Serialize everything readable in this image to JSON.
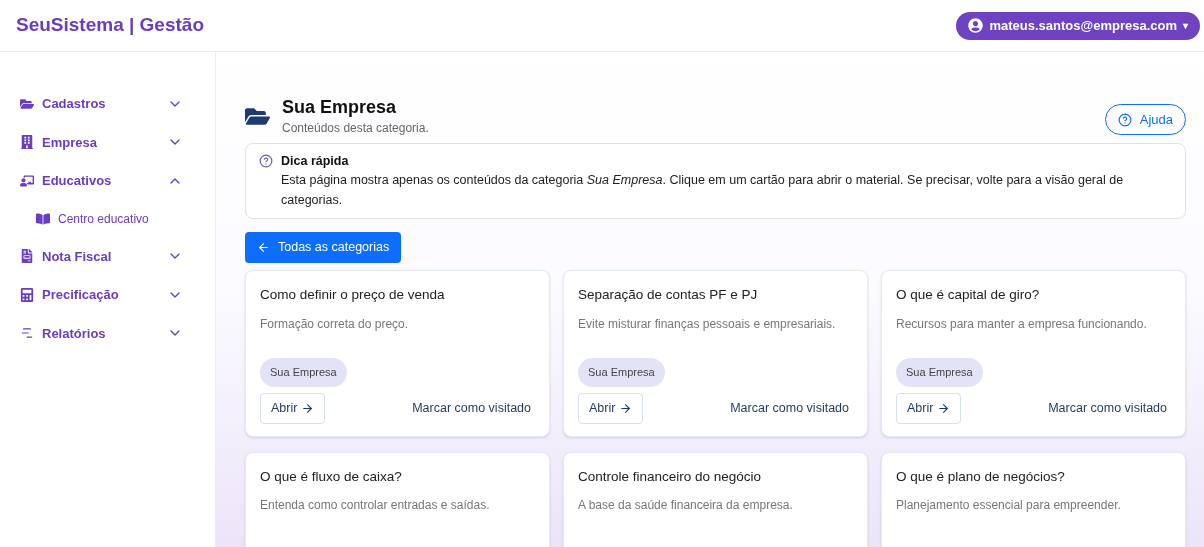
{
  "brand": "SeuSistema | Gestão",
  "user_menu": {
    "label": "mateus.santos@empresa.com",
    "caret": "▾"
  },
  "sidebar": {
    "items": [
      {
        "label": "Cadastros",
        "expanded": false
      },
      {
        "label": "Empresa",
        "expanded": false
      },
      {
        "label": "Educativos",
        "expanded": true,
        "children": [
          {
            "label": "Centro educativo"
          }
        ]
      },
      {
        "label": "Nota Fiscal",
        "expanded": false
      },
      {
        "label": "Precificação",
        "expanded": false
      },
      {
        "label": "Relatórios",
        "expanded": false
      }
    ]
  },
  "page": {
    "title": "Sua Empresa",
    "subtitle": "Conteúdos desta categoria.",
    "help_button": "Ajuda"
  },
  "tip": {
    "title": "Dica rápida",
    "text": "Esta página mostra apenas os conteúdos da categoria *Sua Empresa*. Clique em um cartão para abrir o material. Se precisar, volte para a visão geral de categorias."
  },
  "back_button": "Todas as categorias",
  "cards": [
    {
      "title": "Como definir o preço de venda",
      "description": "Formação correta do preço.",
      "tag": "Sua Empresa",
      "open": "Abrir",
      "mark": "Marcar como visitado"
    },
    {
      "title": "Separação de contas PF e PJ",
      "description": "Evite misturar finanças pessoais e empresariais.",
      "tag": "Sua Empresa",
      "open": "Abrir",
      "mark": "Marcar como visitado"
    },
    {
      "title": "O que é capital de giro?",
      "description": "Recursos para manter a empresa funcionando.",
      "tag": "Sua Empresa",
      "open": "Abrir",
      "mark": "Marcar como visitado"
    },
    {
      "title": "O que é fluxo de caixa?",
      "description": "Entenda como controlar entradas e saídas."
    },
    {
      "title": "Controle financeiro do negócio",
      "description": "A base da saúde financeira da empresa."
    },
    {
      "title": "O que é plano de negócios?",
      "description": "Planejamento essencial para empreender."
    }
  ]
}
